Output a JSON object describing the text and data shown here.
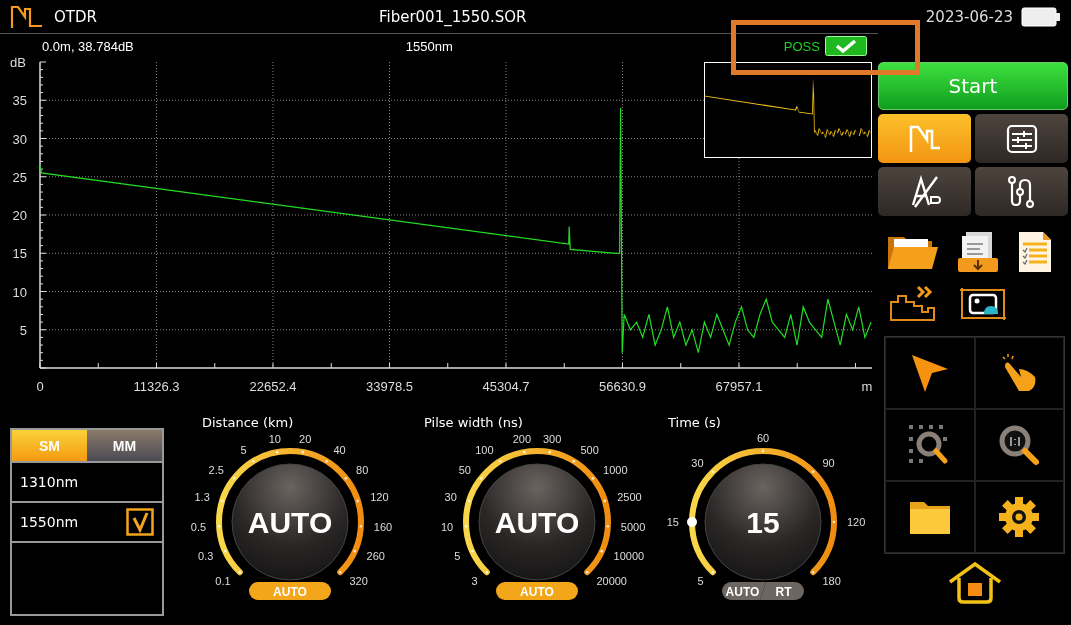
{
  "header": {
    "app_title": "OTDR",
    "file_name": "Fiber001_1550.SOR",
    "date": "2023-06-23"
  },
  "trace_info": {
    "cursor_reading": "0.0m, 38.784dB",
    "wavelength": "1550nm",
    "verdict": {
      "label": "POSS",
      "passed": true
    }
  },
  "trace_panel": {
    "chart_data": {
      "type": "line",
      "xlabel": "m",
      "ylabel": "dB",
      "x": [
        0,
        150,
        51400,
        51450,
        51550,
        56000,
        56350,
        56450,
        56600,
        56800,
        57400,
        58000,
        58600,
        59200,
        59800,
        60400,
        61000,
        61600,
        62200,
        62800,
        63400,
        64000,
        64600,
        65200,
        65800,
        66400,
        67000,
        67600,
        68200,
        68800,
        69400,
        70000,
        70600,
        71200,
        71800,
        72400,
        73000,
        73600,
        74200,
        74800,
        75400,
        76000,
        76600,
        77200,
        77800,
        78400,
        79000,
        79600,
        80200,
        80800
      ],
      "series": [
        {
          "color": "#22dd22",
          "values": [
            26.5,
            25.5,
            16.2,
            18.5,
            15.5,
            15.0,
            15.0,
            34.0,
            2.0,
            7.0,
            5,
            6,
            4,
            7,
            3,
            5,
            8,
            4,
            6,
            3,
            5,
            2,
            6,
            4,
            7,
            5,
            3,
            6,
            8,
            5,
            4,
            7,
            9,
            6,
            5,
            4,
            7,
            3,
            8,
            6,
            5,
            4,
            9,
            6,
            3,
            7,
            5,
            8,
            4,
            6
          ]
        }
      ],
      "xlim": [
        0,
        80890
      ],
      "ylim": [
        0,
        40
      ],
      "xticks": [
        0,
        11326.3,
        22652.4,
        33978.5,
        45304.7,
        56630.9,
        67957.1
      ],
      "yticks": [
        5,
        10,
        15,
        20,
        25,
        30,
        35
      ],
      "grid": true
    }
  },
  "fiber_modes": [
    {
      "label": "SM",
      "selected": true
    },
    {
      "label": "MM",
      "selected": false
    }
  ],
  "wavelengths": [
    {
      "label": "1310nm",
      "checked": false
    },
    {
      "label": "1550nm",
      "checked": true
    }
  ],
  "gauges": [
    {
      "title": "Distance (km)",
      "value": "AUTO",
      "ticks": [
        {
          "label": "0.1",
          "selected": false
        },
        {
          "label": "0.3",
          "selected": false
        },
        {
          "label": "0.5",
          "selected": false
        },
        {
          "label": "1.3",
          "selected": false
        },
        {
          "label": "2.5",
          "selected": false
        },
        {
          "label": "5",
          "selected": false
        },
        {
          "label": "10",
          "selected": false
        },
        {
          "label": "20",
          "selected": false
        },
        {
          "label": "40",
          "selected": false
        },
        {
          "label": "80",
          "selected": false
        },
        {
          "label": "120",
          "selected": false
        },
        {
          "label": "160",
          "selected": false
        },
        {
          "label": "260",
          "selected": false
        },
        {
          "label": "320",
          "selected": false
        }
      ],
      "modes": [
        {
          "label": "AUTO",
          "selected": true
        }
      ]
    },
    {
      "title": "Pilse width (ns)",
      "value": "AUTO",
      "ticks": [
        {
          "label": "3",
          "selected": false
        },
        {
          "label": "5",
          "selected": false
        },
        {
          "label": "10",
          "selected": false
        },
        {
          "label": "30",
          "selected": false
        },
        {
          "label": "50",
          "selected": false
        },
        {
          "label": "100",
          "selected": false
        },
        {
          "label": "200",
          "selected": false
        },
        {
          "label": "300",
          "selected": false
        },
        {
          "label": "500",
          "selected": false
        },
        {
          "label": "1000",
          "selected": false
        },
        {
          "label": "2500",
          "selected": false
        },
        {
          "label": "5000",
          "selected": false
        },
        {
          "label": "10000",
          "selected": false
        },
        {
          "label": "20000",
          "selected": false
        }
      ],
      "modes": [
        {
          "label": "AUTO",
          "selected": true
        }
      ]
    },
    {
      "title": "Time (s)",
      "value": "15",
      "ticks": [
        {
          "label": "5",
          "selected": false
        },
        {
          "label": "15",
          "selected": true
        },
        {
          "label": "30",
          "selected": false
        },
        {
          "label": "60",
          "selected": false
        },
        {
          "label": "90",
          "selected": false
        },
        {
          "label": "120",
          "selected": false
        },
        {
          "label": "180",
          "selected": false
        }
      ],
      "modes": [
        {
          "label": "AUTO",
          "selected": false
        },
        {
          "label": "RT",
          "selected": false
        }
      ]
    }
  ],
  "side_panel": {
    "start_label": "Start",
    "mode_tiles": [
      {
        "kind": "trace",
        "selected": true
      },
      {
        "kind": "settings",
        "selected": false
      },
      {
        "kind": "compare",
        "selected": false
      },
      {
        "kind": "route",
        "selected": false
      }
    ]
  }
}
